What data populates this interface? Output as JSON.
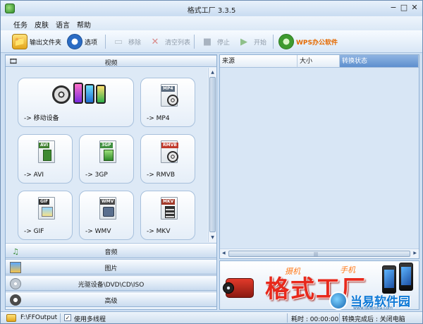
{
  "window": {
    "title": "格式工厂  3.3.5"
  },
  "window_controls": {
    "minimize": "−",
    "maximize": "□",
    "close": "✕"
  },
  "menu": [
    "任务",
    "皮肤",
    "语言",
    "帮助"
  ],
  "toolbar": {
    "output_folder": "输出文件夹",
    "options": "选项",
    "remove": "移除",
    "clear_list": "清空列表",
    "stop": "停止",
    "start": "开始",
    "wps": "WPS办公软件"
  },
  "categories": {
    "video": "视频",
    "audio": "音频",
    "image": "图片",
    "disc": "光驱设备\\DVD\\CD\\ISO",
    "advanced": "高级"
  },
  "formats": [
    {
      "label": "-> 移动设备",
      "tag": "",
      "tag_color": ""
    },
    {
      "label": "-> MP4",
      "tag": "MP4",
      "tag_color": "#5a6b7d"
    },
    {
      "label": "-> AVI",
      "tag": "AVI",
      "tag_color": "#3f7f2f"
    },
    {
      "label": "-> 3GP",
      "tag": "3GP",
      "tag_color": "#3f8f3f"
    },
    {
      "label": "-> RMVB",
      "tag": "RMVB",
      "tag_color": "#c0392b"
    },
    {
      "label": "-> GIF",
      "tag": "GIF",
      "tag_color": "#333333"
    },
    {
      "label": "-> WMV",
      "tag": "WMV",
      "tag_color": "#4a4a4a"
    },
    {
      "label": "-> MKV",
      "tag": "MKV",
      "tag_color": "#a33b2b"
    }
  ],
  "task_table": {
    "columns": [
      "来源",
      "大小",
      "转换状态"
    ]
  },
  "banner": {
    "main": "格式工厂",
    "sub_left": "摄机",
    "sub_right": "手机"
  },
  "watermark": {
    "text": "当易软件园",
    "url": "www.downxia.com"
  },
  "status": {
    "output_path": "F:\\FFOutput",
    "multithread_label": "使用多线程",
    "multithread_checked": "✓",
    "elapsed": "耗时 : 00:00:00",
    "after_done": "转换完成后 : 关闭电脑"
  },
  "colors": {
    "accent": "#5d8fce",
    "banner_red": "#e8291c",
    "wps_orange": "#e56a00"
  }
}
